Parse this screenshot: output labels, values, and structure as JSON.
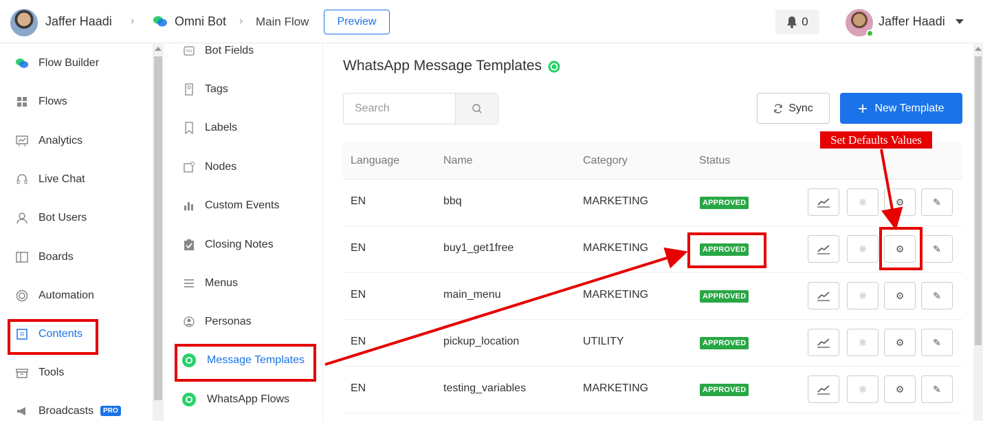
{
  "topbar": {
    "workspace_name": "Jaffer Haadi",
    "bot_name": "Omni Bot",
    "flow_name": "Main Flow",
    "preview_label": "Preview",
    "notification_count": "0",
    "user_name": "Jaffer Haadi"
  },
  "sidebar": {
    "items": [
      {
        "label": "Flow Builder",
        "icon": "chat-bubbles-icon"
      },
      {
        "label": "Flows",
        "icon": "grid-icon"
      },
      {
        "label": "Analytics",
        "icon": "chart-board-icon"
      },
      {
        "label": "Live Chat",
        "icon": "headset-icon"
      },
      {
        "label": "Bot Users",
        "icon": "user-icon"
      },
      {
        "label": "Boards",
        "icon": "board-icon"
      },
      {
        "label": "Automation",
        "icon": "automation-icon"
      },
      {
        "label": "Contents",
        "icon": "contents-icon",
        "active": true
      },
      {
        "label": "Tools",
        "icon": "toolbox-icon"
      },
      {
        "label": "Broadcasts",
        "icon": "megaphone-icon",
        "badge": "PRO"
      }
    ]
  },
  "subnav": {
    "items": [
      {
        "label": "Bot Fields",
        "icon": "fields-icon"
      },
      {
        "label": "Tags",
        "icon": "tag-icon"
      },
      {
        "label": "Labels",
        "icon": "bookmark-icon"
      },
      {
        "label": "Nodes",
        "icon": "node-icon"
      },
      {
        "label": "Custom Events",
        "icon": "bar-chart-icon"
      },
      {
        "label": "Closing Notes",
        "icon": "clipboard-check-icon"
      },
      {
        "label": "Menus",
        "icon": "menu-icon"
      },
      {
        "label": "Personas",
        "icon": "persona-icon"
      },
      {
        "label": "Message Templates",
        "icon": "whatsapp-icon",
        "active": true
      },
      {
        "label": "WhatsApp Flows",
        "icon": "whatsapp-icon"
      }
    ]
  },
  "main": {
    "title": "WhatsApp Message Templates",
    "search_placeholder": "Search",
    "sync_label": "Sync",
    "new_template_label": "New Template",
    "columns": [
      "Language",
      "Name",
      "Category",
      "Status"
    ],
    "rows": [
      {
        "language": "EN",
        "name": "bbq",
        "category": "MARKETING",
        "status": "APPROVED"
      },
      {
        "language": "EN",
        "name": "buy1_get1free",
        "category": "MARKETING",
        "status": "APPROVED"
      },
      {
        "language": "EN",
        "name": "main_menu",
        "category": "MARKETING",
        "status": "APPROVED"
      },
      {
        "language": "EN",
        "name": "pickup_location",
        "category": "UTILITY",
        "status": "APPROVED"
      },
      {
        "language": "EN",
        "name": "testing_variables",
        "category": "MARKETING",
        "status": "APPROVED"
      }
    ]
  },
  "annotation": {
    "label": "Set Defaults Values",
    "color": "#e60000"
  },
  "colors": {
    "accent": "#1a73e8",
    "approved": "#28a745",
    "whatsapp": "#25d366"
  }
}
